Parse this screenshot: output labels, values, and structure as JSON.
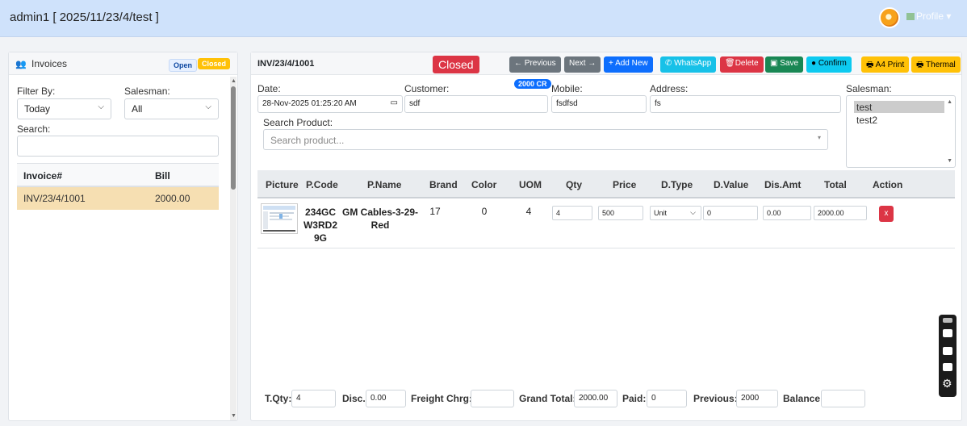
{
  "topbar": {
    "title": "admin1 [ 2025/11/23/4/test ]",
    "profile_label": "Profile"
  },
  "left": {
    "title": "Invoices",
    "badge_open": "Open",
    "badge_closed": "Closed",
    "filter_label": "Filter By:",
    "filter_value": "Today",
    "salesman_label": "Salesman:",
    "salesman_value": "All",
    "search_label": "Search:",
    "table": {
      "headers": [
        "Invoice#",
        "Bill"
      ],
      "rows": [
        {
          "invoice": "INV/23/4/1001",
          "bill": "2000.00"
        }
      ]
    }
  },
  "right": {
    "invoice_no": "INV/23/4/1001",
    "status": "Closed",
    "buttons": {
      "previous": "← Previous",
      "next": "Next →",
      "add_new": "+ Add New",
      "whatsapp": "WhatsApp",
      "delete": "Delete",
      "save": "Save",
      "confirm": "Confirm",
      "a4_print": "A4 Print",
      "thermal": "Thermal"
    },
    "form": {
      "date_label": "Date:",
      "date_value": "28-Nov-2025 01:25:20 AM",
      "customer_label": "Customer:",
      "customer_value": "sdf",
      "credit_badge": "2000 CR",
      "mobile_label": "Mobile:",
      "mobile_value": "fsdfsd",
      "address_label": "Address:",
      "address_value": "fs",
      "salesman_label": "Salesman:",
      "salesmen": [
        "test",
        "test2"
      ],
      "search_product_label": "Search Product:",
      "search_product_placeholder": "Search product..."
    },
    "products": {
      "headers": [
        "Picture",
        "P.Code",
        "P.Name",
        "Brand",
        "Color",
        "UOM",
        "Qty",
        "Price",
        "D.Type",
        "D.Value",
        "Dis.Amt",
        "Total",
        "Action"
      ],
      "rows": [
        {
          "pcode_lines": [
            "234GC",
            "W3RD2",
            "9G"
          ],
          "pname_lines": [
            "GM Cables-3-29-",
            "Red"
          ],
          "brand": "17",
          "color": "0",
          "uom": "4",
          "qty": "4",
          "price": "500",
          "dtype": "Unit",
          "dvalue": "0",
          "disamt": "0.00",
          "total": "2000.00",
          "action": "x"
        }
      ]
    },
    "totals": {
      "tqty_label": "T.Qty:",
      "tqty": "4",
      "disc_label": "Disc.:",
      "disc": "0.00",
      "freight_label": "Freight Chrg:",
      "freight": "",
      "grand_label": "Grand Total:",
      "grand": "2000.00",
      "paid_label": "Paid:",
      "paid": "0",
      "previous_label": "Previous:",
      "previous": "2000",
      "balance_label": "Balance:",
      "balance": ""
    }
  },
  "colors": {
    "topbar": "#cfe2fb",
    "danger": "#dc3545",
    "primary": "#0d6efd",
    "warning": "#ffc107",
    "success": "#198754",
    "info": "#0dcaf0"
  }
}
